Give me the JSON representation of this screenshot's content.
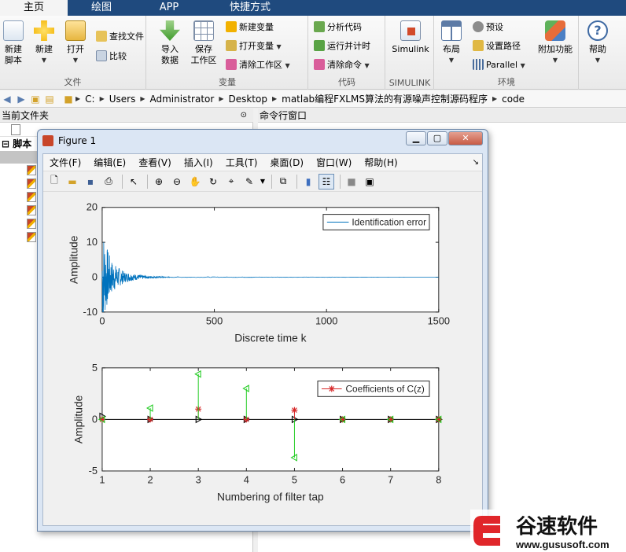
{
  "tabs": [
    {
      "label": "主页",
      "width": 86,
      "active": true
    },
    {
      "label": "绘图",
      "width": 86
    },
    {
      "label": "APP",
      "width": 86
    },
    {
      "label": "快捷方式",
      "width": 120
    }
  ],
  "ribbon": {
    "file": {
      "label": "文件",
      "new_script": "新建\n脚本",
      "new": "新建",
      "open": "打开",
      "find_files": "查找文件",
      "compare": "比较"
    },
    "variable": {
      "label": "变量",
      "import": "导入\n数据",
      "save_ws": "保存\n工作区",
      "new_var": "新建变量",
      "open_var": "打开变量",
      "clear_ws": "清除工作区"
    },
    "code": {
      "label": "代码",
      "analyze": "分析代码",
      "run_time": "运行并计时",
      "clear_cmd": "清除命令"
    },
    "simulink": {
      "label": "SIMULINK",
      "button": "Simulink"
    },
    "env": {
      "label": "环境",
      "layout": "布局",
      "prefs": "预设",
      "set_path": "设置路径",
      "parallel": "Parallel",
      "addons": "附加功能"
    },
    "resources": {
      "help": "帮助"
    }
  },
  "address": {
    "crumbs": [
      "C:",
      "Users",
      "Administrator",
      "Desktop",
      "matlab编程FXLMS算法的有源噪声控制源码程序",
      "code"
    ]
  },
  "left_panel": {
    "title": "当前文件夹",
    "tree_root": "脚本"
  },
  "right_panel": {
    "title": "命令行窗口"
  },
  "figure": {
    "title": "Figure 1",
    "menu": [
      "文件(F)",
      "编辑(E)",
      "查看(V)",
      "插入(I)",
      "工具(T)",
      "桌面(D)",
      "窗口(W)",
      "帮助(H)"
    ],
    "top_plot": {
      "xlabel": "Discrete time k",
      "ylabel": "Amplitude",
      "legend": "Identification error",
      "xticks": [
        "0",
        "500",
        "1000",
        "1500"
      ],
      "yticks": [
        "20",
        "10",
        "0",
        "-10"
      ]
    },
    "bottom_plot": {
      "xlabel": "Numbering of filter tap",
      "ylabel": "Amplitude",
      "legend": "Coefficients of C(z)",
      "xticks": [
        "1",
        "2",
        "3",
        "4",
        "5",
        "6",
        "7",
        "8"
      ],
      "yticks": [
        "5",
        "0",
        "-5"
      ]
    }
  },
  "watermark": {
    "brand": "谷速软件",
    "url": "www.gususoft.com"
  },
  "chart_data": [
    {
      "type": "line",
      "title": "",
      "xlabel": "Discrete time k",
      "ylabel": "Amplitude",
      "xlim": [
        0,
        1500
      ],
      "ylim": [
        -10,
        20
      ],
      "legend": "top-right",
      "series": [
        {
          "name": "Identification error",
          "color": "#0072bd",
          "x": [
            0,
            5,
            10,
            20,
            30,
            40,
            60,
            80,
            100,
            150,
            200,
            300,
            1500
          ],
          "envelope": [
            16,
            14,
            12,
            9,
            7,
            5,
            3.5,
            2.5,
            1.5,
            0.8,
            0.4,
            0.1,
            0
          ]
        }
      ]
    },
    {
      "type": "stem",
      "title": "",
      "xlabel": "Numbering of filter tap",
      "ylabel": "Amplitude",
      "xlim": [
        1,
        8
      ],
      "ylim": [
        -5,
        5
      ],
      "legend": "top-right",
      "series": [
        {
          "name": "Coefficients of C(z)",
          "color": "#d62728",
          "marker": "*",
          "x": [
            1,
            2,
            3,
            4,
            5,
            6,
            7,
            8
          ],
          "values": [
            0,
            0,
            1,
            0,
            0.9,
            0,
            0,
            0
          ]
        },
        {
          "color": "#22cc22",
          "marker": "triangle-left",
          "x": [
            1,
            2,
            3,
            4,
            5,
            6,
            7,
            8
          ],
          "values": [
            0,
            1.1,
            4.4,
            3.0,
            -3.7,
            0,
            0,
            0
          ]
        },
        {
          "color": "#000000",
          "marker": "triangle-right",
          "x": [
            1,
            2,
            3,
            4,
            5,
            6,
            7,
            8
          ],
          "values": [
            0.3,
            0,
            0,
            0,
            0,
            0,
            0,
            0
          ]
        }
      ]
    }
  ]
}
